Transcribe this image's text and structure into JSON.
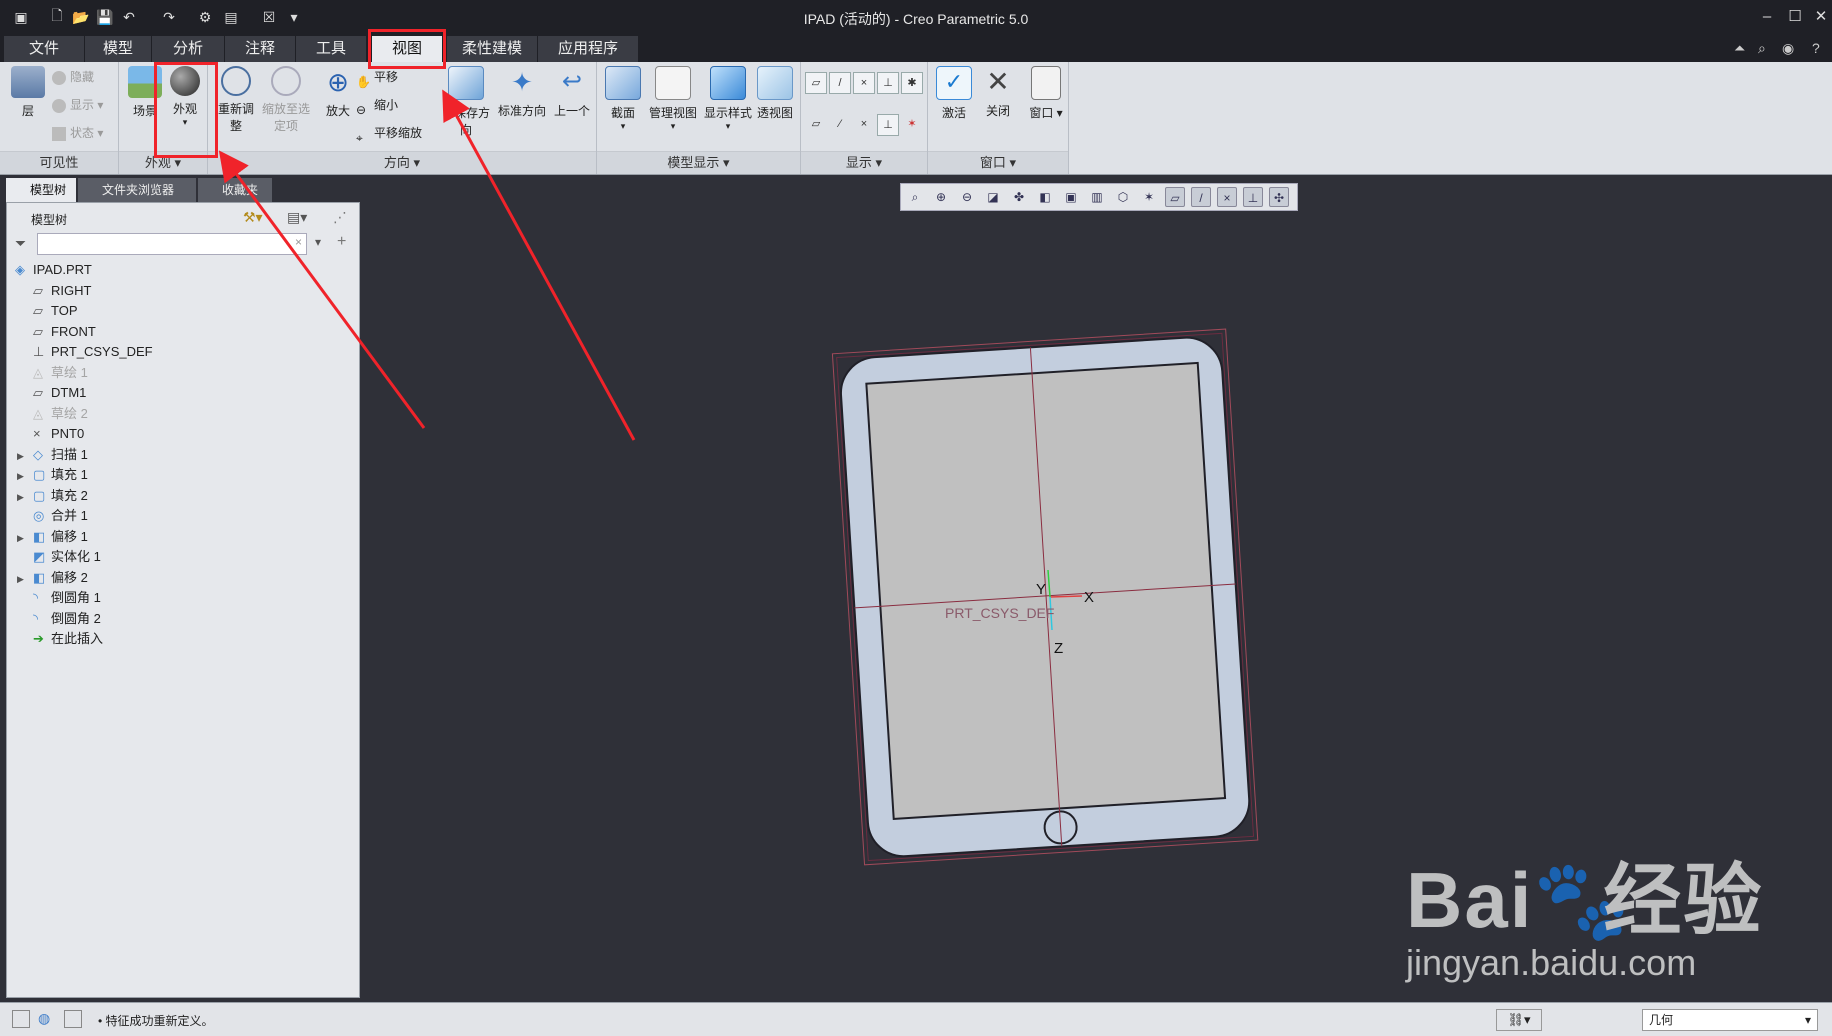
{
  "window": {
    "title": "IPAD (活动的) - Creo Parametric 5.0"
  },
  "tabs": [
    {
      "label": "文件"
    },
    {
      "label": "模型"
    },
    {
      "label": "分析"
    },
    {
      "label": "注释"
    },
    {
      "label": "工具"
    },
    {
      "label": "视图"
    },
    {
      "label": "柔性建模"
    },
    {
      "label": "应用程序"
    }
  ],
  "active_tab": "视图",
  "ribbon": {
    "visibility": {
      "layer": "层",
      "hide": "隐藏",
      "show": "显示",
      "status": "状态",
      "label": "可见性"
    },
    "appearance": {
      "scene": "场景",
      "appearance": "外观",
      "label": "外观"
    },
    "orientation": {
      "refit": "重新调整",
      "zoom_to_selected": "缩放至选定项",
      "zoom_in": "放大",
      "pan": "平移",
      "zoom_out": "缩小",
      "pan_zoom": "平移缩放",
      "saved_orientations": "已保存方向",
      "standard_orientation": "标准方向",
      "previous": "上一个",
      "label": "方向"
    },
    "model_display": {
      "section": "截面",
      "manage_views": "管理视图",
      "display_style": "显示样式",
      "perspective": "透视图",
      "label": "模型显示"
    },
    "show": {
      "label": "显示"
    },
    "window": {
      "activate": "激活",
      "close": "关闭",
      "windows": "窗口",
      "label": "窗口"
    }
  },
  "panel": {
    "tabs": [
      {
        "label": "模型树"
      },
      {
        "label": "文件夹浏览器"
      },
      {
        "label": "收藏夹"
      }
    ],
    "tree_title": "模型树",
    "filter_placeholder": ""
  },
  "tree": [
    {
      "label": "IPAD.PRT",
      "indent": 0,
      "expandable": false,
      "dim": false,
      "icon": "part-icon"
    },
    {
      "label": "RIGHT",
      "indent": 1,
      "expandable": false,
      "dim": false,
      "icon": "datum-plane-icon"
    },
    {
      "label": "TOP",
      "indent": 1,
      "expandable": false,
      "dim": false,
      "icon": "datum-plane-icon"
    },
    {
      "label": "FRONT",
      "indent": 1,
      "expandable": false,
      "dim": false,
      "icon": "datum-plane-icon"
    },
    {
      "label": "PRT_CSYS_DEF",
      "indent": 1,
      "expandable": false,
      "dim": false,
      "icon": "csys-icon"
    },
    {
      "label": "草绘 1",
      "indent": 1,
      "expandable": false,
      "dim": true,
      "icon": "sketch-icon"
    },
    {
      "label": "DTM1",
      "indent": 1,
      "expandable": false,
      "dim": false,
      "icon": "datum-plane-icon"
    },
    {
      "label": "草绘 2",
      "indent": 1,
      "expandable": false,
      "dim": true,
      "icon": "sketch-icon"
    },
    {
      "label": "PNT0",
      "indent": 1,
      "expandable": false,
      "dim": false,
      "icon": "datum-point-icon"
    },
    {
      "label": "扫描 1",
      "indent": 1,
      "expandable": true,
      "dim": false,
      "icon": "sweep-icon"
    },
    {
      "label": "填充 1",
      "indent": 1,
      "expandable": true,
      "dim": false,
      "icon": "fill-icon"
    },
    {
      "label": "填充 2",
      "indent": 1,
      "expandable": true,
      "dim": false,
      "icon": "fill-icon"
    },
    {
      "label": "合并 1",
      "indent": 1,
      "expandable": false,
      "dim": false,
      "icon": "merge-icon"
    },
    {
      "label": "偏移 1",
      "indent": 1,
      "expandable": true,
      "dim": false,
      "icon": "offset-icon"
    },
    {
      "label": "实体化 1",
      "indent": 1,
      "expandable": false,
      "dim": false,
      "icon": "solidify-icon"
    },
    {
      "label": "偏移 2",
      "indent": 1,
      "expandable": true,
      "dim": false,
      "icon": "offset-icon"
    },
    {
      "label": "倒圆角 1",
      "indent": 1,
      "expandable": false,
      "dim": false,
      "icon": "round-icon"
    },
    {
      "label": "倒圆角 2",
      "indent": 1,
      "expandable": false,
      "dim": false,
      "icon": "round-icon"
    },
    {
      "label": "在此插入",
      "indent": 1,
      "expandable": false,
      "dim": false,
      "icon": "insert-here-icon"
    }
  ],
  "viewport": {
    "csys_label": "PRT_CSYS_DEF",
    "axis_x": "X",
    "axis_y": "Y",
    "axis_z": "Z"
  },
  "status": {
    "message": "• 特征成功重新定义。",
    "filter_value": "几何"
  },
  "watermark": {
    "line1": "Bai",
    "line2": "经验",
    "url": "jingyan.baidu.com"
  },
  "colors": {
    "highlight": "#f0232a",
    "viewport_bg": "#2f3038",
    "device_fill": "#c3cede",
    "screen_fill": "#c0c0c0"
  }
}
